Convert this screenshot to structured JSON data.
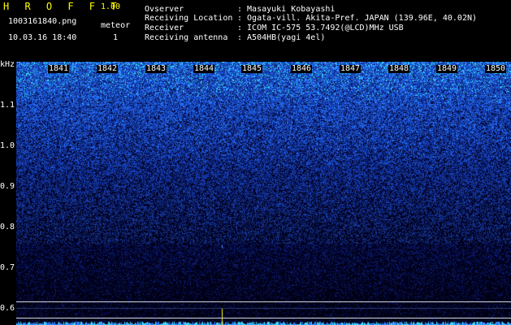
{
  "app": {
    "title": "H R O F F T",
    "version": "1.00",
    "filename": "1003161840.png",
    "datetime": "10.03.16 18:40",
    "meteor_label": "meteor",
    "meteor_count": "1"
  },
  "info": {
    "observer_label": "Ovserver",
    "observer_value": ": Masayuki Kobayashi",
    "location_label": "Receiving Location",
    "location_value": ": Ogata-vill. Akita-Pref. JAPAN (139.96E, 40.02N)",
    "receiver_label": "Receiver",
    "receiver_value": ": ICOM IC-575 53.7492(@LCD)MHz USB",
    "antenna_label": "Receiving antenna",
    "antenna_value": ": A504HB(yagi 4el)"
  },
  "spectrogram": {
    "y_unit": "kHz",
    "y_ticks": [
      "1.1",
      "1.0",
      "0.9",
      "0.8",
      "0.7",
      "0.6"
    ],
    "x_ticks": [
      "1841",
      "1842",
      "1843",
      "1844",
      "1845",
      "1846",
      "1847",
      "1848",
      "1849",
      "1850"
    ],
    "colors": {
      "background": "#000010",
      "noise": "#1a3cff",
      "hot": "#40ffff",
      "marker": "#ffff00"
    }
  }
}
